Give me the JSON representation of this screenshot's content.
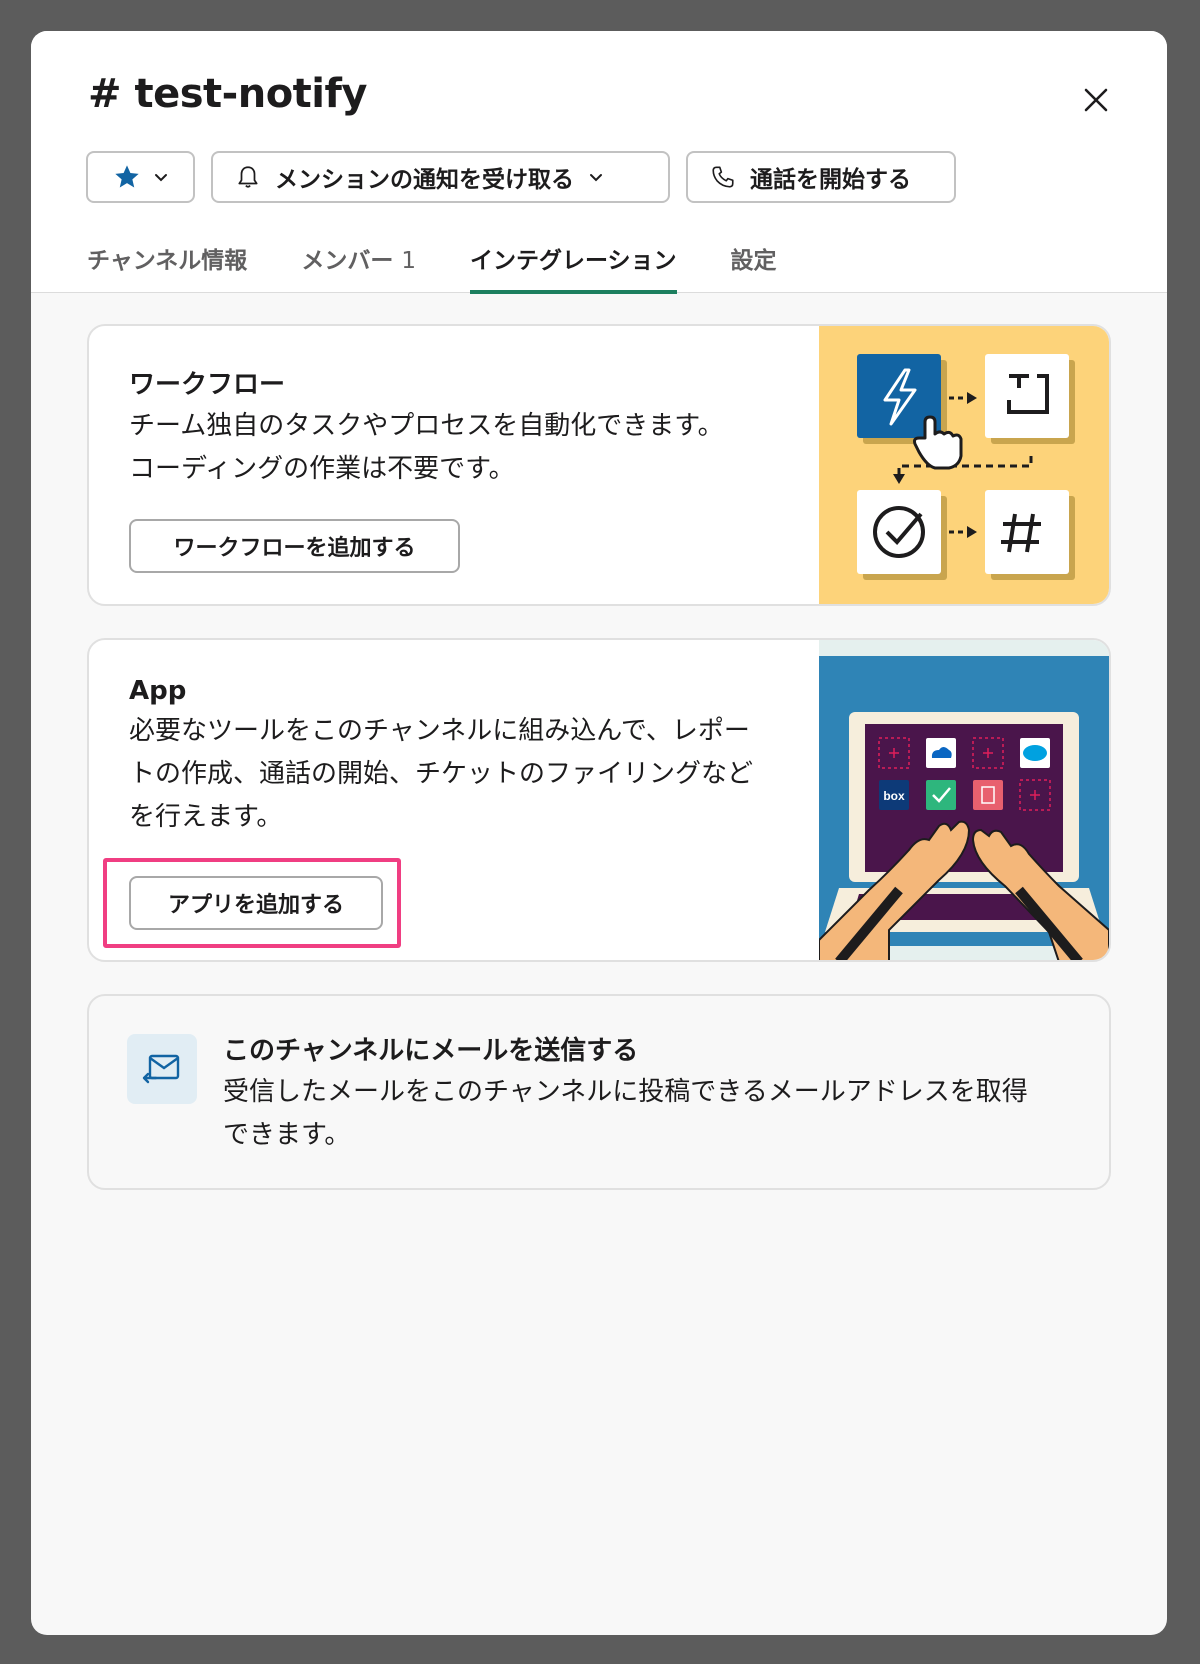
{
  "modal": {
    "title": "# test-notify",
    "close_icon": "close-icon"
  },
  "actions": {
    "star_icon": "star-icon",
    "chevron_icon": "chevron-down-icon",
    "notify_label": "メンションの通知を受け取る",
    "call_label": "通話を開始する"
  },
  "tabs": [
    {
      "label": "チャンネル情報",
      "active": false
    },
    {
      "label": "メンバー",
      "count": "1",
      "active": false
    },
    {
      "label": "インテグレーション",
      "active": true
    },
    {
      "label": "設定",
      "active": false
    }
  ],
  "workflow": {
    "title": "ワークフロー",
    "description": "チーム独自のタスクやプロセスを自動化できます。コーディングの作業は不要です。",
    "button_label": "ワークフローを追加する"
  },
  "apps": {
    "title": "App",
    "description": "必要なツールをこのチャンネルに組み込んで、レポートの作成、通話の開始、チケットのファイリングなどを行えます。",
    "button_label": "アプリを追加する",
    "box_logo_text": "box"
  },
  "email": {
    "title": "このチャンネルにメールを送信する",
    "description": "受信したメールをこのチャンネルに投稿できるメールアドレスを取得できます。"
  },
  "colors": {
    "accent_tab": "#1d7f5f",
    "highlight": "#f03e82",
    "workflow_bg": "#fdd37a",
    "apps_bg": "#2f84b6",
    "star": "#1264a3"
  }
}
